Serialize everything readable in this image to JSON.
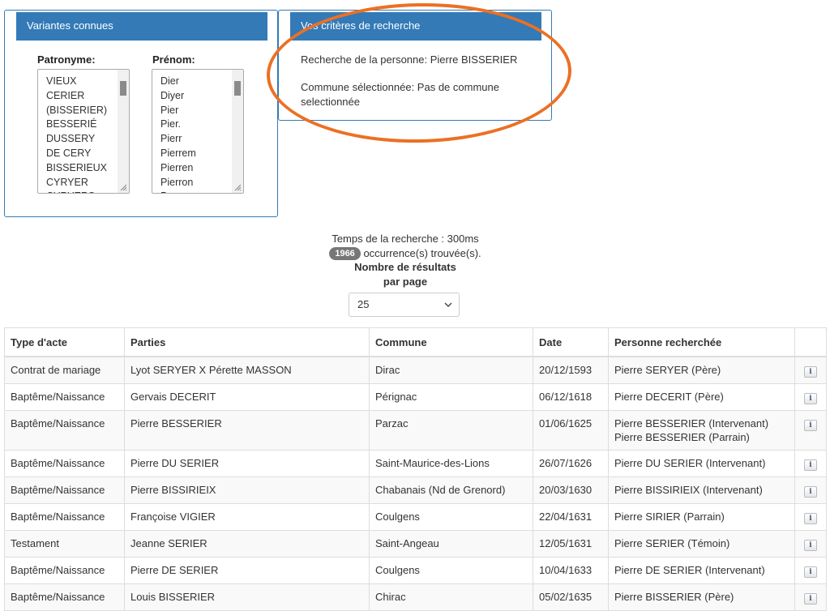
{
  "variants": {
    "title": "Variantes connues",
    "surname_label": "Patronyme:",
    "firstname_label": "Prénom:",
    "surnames": [
      "VIEUX",
      "CERIER",
      "(BISSERIER)",
      "BESSERIÉ",
      "DUSSERY",
      "DE CERY",
      "BISSERIEUX",
      "CYRYER",
      "CYRYERS"
    ],
    "firstnames": [
      "Dier",
      "Diyer",
      "Pier",
      "Pier.",
      "Pierr",
      "Pierrem",
      "Pierren",
      "Pierron",
      "Pyer"
    ]
  },
  "criteria": {
    "title": "Vos critères de recherche",
    "person": "Recherche de la personne: Pierre BISSERIER",
    "commune_line1": "Commune sélectionnée: Pas de commune",
    "commune_line2": "selectionnée"
  },
  "search": {
    "time": "Temps de la recherche : 300ms",
    "count": "1966",
    "count_suffix": "occurrence(s) trouvée(s).",
    "per_page_line1": "Nombre de résultats",
    "per_page_line2": "par page",
    "per_page_value": "25"
  },
  "table": {
    "headers": [
      "Type d'acte",
      "Parties",
      "Commune",
      "Date",
      "Personne recherchée",
      ""
    ],
    "info_icon": "i",
    "rows": [
      {
        "type": "Contrat de mariage",
        "parties": "Lyot SERYER X Pérette MASSON",
        "commune": "Dirac",
        "date": "20/12/1593",
        "person": "Pierre SERYER (Père)",
        "person2": ""
      },
      {
        "type": "Baptême/Naissance",
        "parties": "Gervais DECERIT",
        "commune": "Pérignac",
        "date": "06/12/1618",
        "person": "Pierre DECERIT (Père)",
        "person2": ""
      },
      {
        "type": "Baptême/Naissance",
        "parties": "Pierre BESSERIER",
        "commune": "Parzac",
        "date": "01/06/1625",
        "person": "Pierre BESSERIER (Intervenant)",
        "person2": "Pierre BESSERIER (Parrain)"
      },
      {
        "type": "Baptême/Naissance",
        "parties": "Pierre DU SERIER",
        "commune": "Saint-Maurice-des-Lions",
        "date": "26/07/1626",
        "person": "Pierre DU SERIER (Intervenant)",
        "person2": ""
      },
      {
        "type": "Baptême/Naissance",
        "parties": "Pierre BISSIRIEIX",
        "commune": "Chabanais (Nd de Grenord)",
        "date": "20/03/1630",
        "person": "Pierre BISSIRIEIX (Intervenant)",
        "person2": ""
      },
      {
        "type": "Baptême/Naissance",
        "parties": "Françoise VIGIER",
        "commune": "Coulgens",
        "date": "22/04/1631",
        "person": "Pierre SIRIER (Parrain)",
        "person2": ""
      },
      {
        "type": "Testament",
        "parties": "Jeanne SERIER",
        "commune": "Saint-Angeau",
        "date": "12/05/1631",
        "person": "Pierre SERIER (Témoin)",
        "person2": ""
      },
      {
        "type": "Baptême/Naissance",
        "parties": "Pierre DE SERIER",
        "commune": "Coulgens",
        "date": "10/04/1633",
        "person": "Pierre DE SERIER (Intervenant)",
        "person2": ""
      },
      {
        "type": "Baptême/Naissance",
        "parties": "Louis BISSERIER",
        "commune": "Chirac",
        "date": "05/02/1635",
        "person": "Pierre BISSERIER (Père)",
        "person2": ""
      }
    ]
  },
  "colors": {
    "panel": "#337ab7",
    "highlight": "#ec7024",
    "badge": "#777777"
  }
}
